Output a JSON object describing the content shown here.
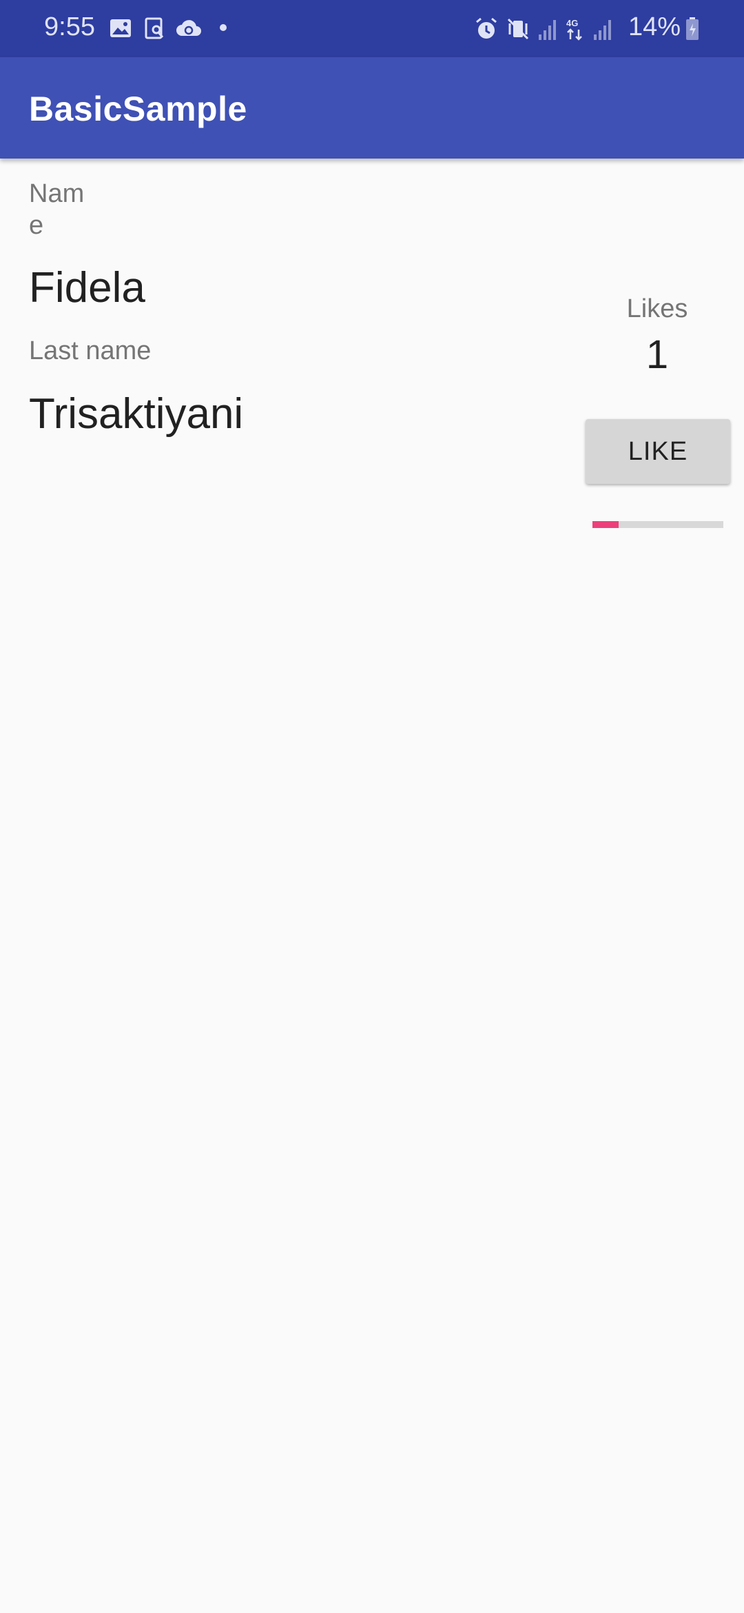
{
  "status_bar": {
    "time": "9:55",
    "battery": "14%",
    "icons": [
      "image-icon",
      "screenshot-icon",
      "cloud-sync-icon",
      "dot-icon",
      "alarm-icon",
      "vibrate-icon",
      "signal-icon",
      "4g-icon",
      "signal-icon",
      "battery-icon"
    ]
  },
  "app_bar": {
    "title": "BasicSample",
    "color": "#3f51b5"
  },
  "form": {
    "name_label": "Name",
    "name_value": "Fidela",
    "lastname_label": "Last name",
    "lastname_value": "Trisaktiyani"
  },
  "likes": {
    "label": "Likes",
    "count": "1",
    "button_label": "LIKE",
    "progress_fraction": 0.2,
    "progress_color": "#ec407a"
  }
}
